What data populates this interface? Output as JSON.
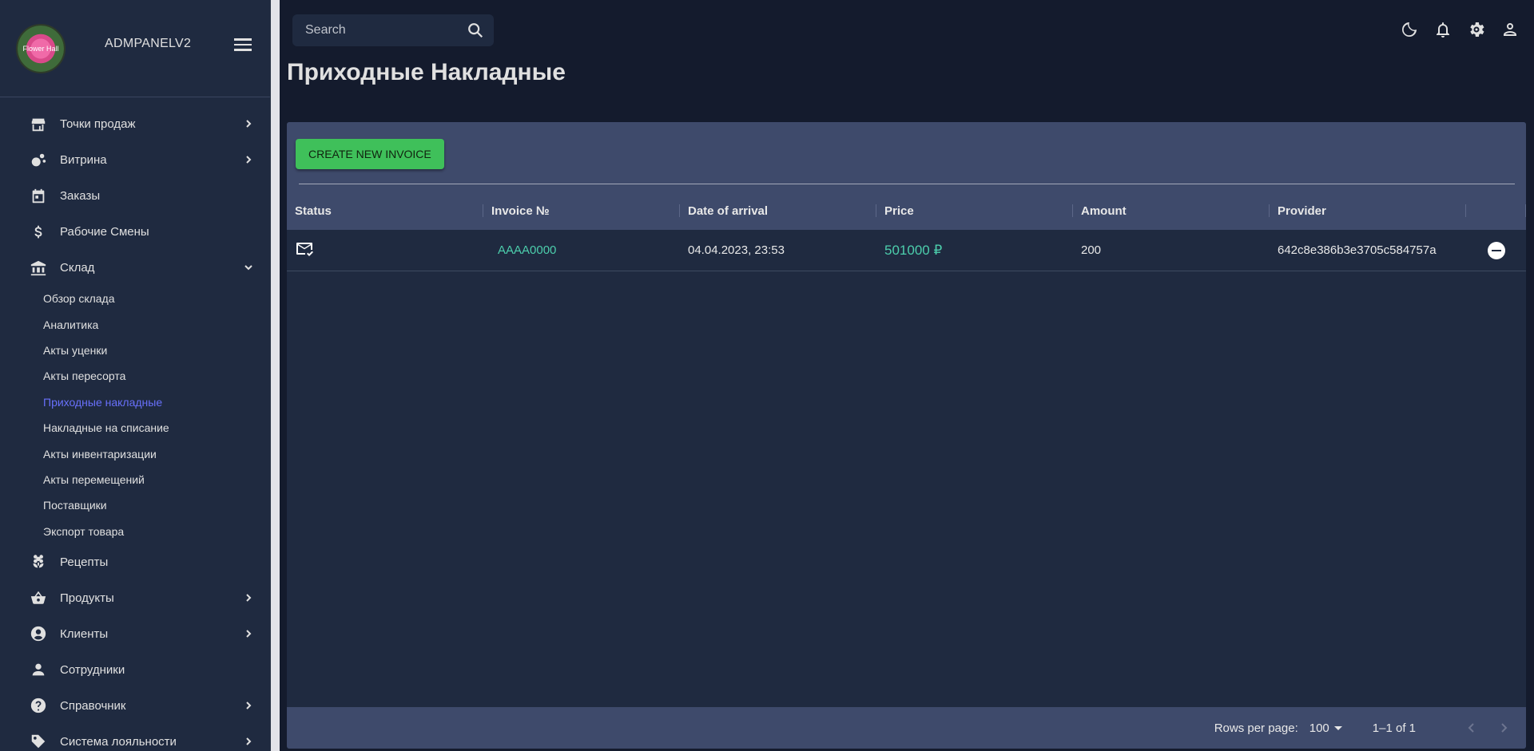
{
  "app": {
    "name": "ADMPANELV2",
    "logo_text": "Flower Hall"
  },
  "search": {
    "placeholder": "Search"
  },
  "page": {
    "title": "Приходные Накладные"
  },
  "sidebar": {
    "items": [
      {
        "label": "Точки продаж",
        "icon": "store-icon"
      },
      {
        "label": "Витрина",
        "icon": "showcase-icon"
      },
      {
        "label": "Заказы",
        "icon": "calendar-icon"
      },
      {
        "label": "Рабочие Смены",
        "icon": "dollar-icon"
      },
      {
        "label": "Склад",
        "icon": "bank-icon"
      }
    ],
    "warehouse_sub": [
      "Обзор склада",
      "Аналитика",
      "Акты уценки",
      "Акты пересорта",
      "Приходные накладные",
      "Накладные на списание",
      "Акты инвентаризации",
      "Акты перемещений",
      "Поставщики",
      "Экспорт товара"
    ],
    "items_after": [
      {
        "label": "Рецепты",
        "icon": "flower-icon"
      },
      {
        "label": "Продукты",
        "icon": "basket-icon"
      },
      {
        "label": "Клиенты",
        "icon": "account-circle-icon"
      },
      {
        "label": "Сотрудники",
        "icon": "person-icon"
      },
      {
        "label": "Справочник",
        "icon": "help-icon"
      },
      {
        "label": "Система лояльности",
        "icon": "tag-icon"
      }
    ]
  },
  "toolbar": {
    "create_label": "CREATE NEW INVOICE"
  },
  "table": {
    "columns": [
      "Status",
      "Invoice №",
      "Date of arrival",
      "Price",
      "Amount",
      "Provider"
    ],
    "rows": [
      {
        "invoice": "AAAA0000",
        "date": "04.04.2023, 23:53",
        "price": "501000 ₽",
        "amount": "200",
        "provider": "642c8e386b3e3705c584757a"
      }
    ]
  },
  "pagination": {
    "rows_per_page_label": "Rows per page:",
    "rows_per_page": "100",
    "range": "1–1 of 1"
  },
  "colors": {
    "accent_green": "#4cceac",
    "button_green": "#3fc05a",
    "active_link": "#6870fa"
  }
}
